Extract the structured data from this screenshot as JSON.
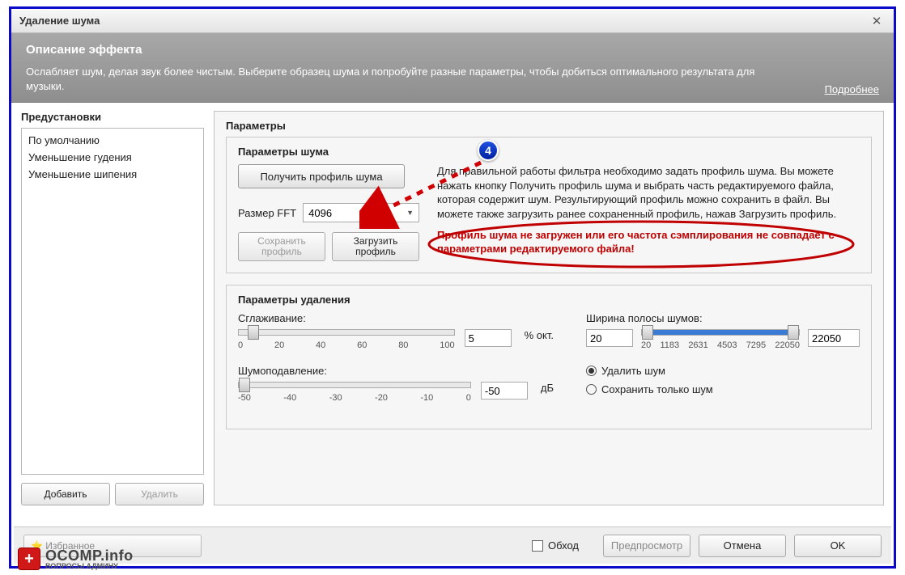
{
  "window": {
    "title": "Удаление шума"
  },
  "desc": {
    "heading": "Описание эффекта",
    "text": "Ослабляет шум, делая звук более чистым. Выберите образец шума и попробуйте разные параметры, чтобы добиться оптимального результата для музыки.",
    "more": "Подробнее"
  },
  "presets": {
    "title": "Предустановки",
    "items": [
      "По умолчанию",
      "Уменьшение гудения",
      "Уменьшение шипения"
    ],
    "add": "Добавить",
    "remove": "Удалить"
  },
  "params": {
    "title": "Параметры",
    "noise": {
      "title": "Параметры шума",
      "get_profile": "Получить профиль шума",
      "fft_label": "Размер FFT",
      "fft_value": "4096",
      "save_profile": "Сохранить профиль",
      "load_profile": "Загрузить профиль",
      "info": "Для правильной работы фильтра необходимо задать профиль шума. Вы можете нажать кнопку Получить профиль шума и выбрать часть редактируемого файла, которая содержит шум. Результирующий профиль можно сохранить в файл. Вы можете также загрузить ранее сохраненный профиль, нажав Загрузить профиль.",
      "warning": "Профиль шума не загружен или его частота сэмплирования не совпадает с параметрами редактируемого файла!"
    },
    "del": {
      "title": "Параметры удаления",
      "smoothing_label": "Сглаживание:",
      "smoothing_value": "5",
      "smoothing_unit": "% окт.",
      "smoothing_ticks": [
        "0",
        "20",
        "40",
        "60",
        "80",
        "100"
      ],
      "reduction_label": "Шумоподавление:",
      "reduction_value": "-50",
      "reduction_unit": "дБ",
      "reduction_ticks": [
        "-50",
        "-40",
        "-30",
        "-20",
        "-10",
        "0"
      ],
      "band_label": "Ширина полосы шумов:",
      "band_low": "20",
      "band_high": "22050",
      "band_ticks": [
        "20",
        "1183",
        "2631",
        "4503",
        "7295",
        "22050"
      ],
      "radio_remove": "Удалить шум",
      "radio_keep": "Сохранить только шум"
    }
  },
  "footer": {
    "favs": "Избранное",
    "bypass": "Обход",
    "preview": "Предпросмотр",
    "cancel": "Отмена",
    "ok": "OK"
  },
  "annotation": {
    "badge": "4"
  },
  "watermark": {
    "main": "OCOMP.info",
    "sub": "ВОПРОСЫ АДМИНУ"
  }
}
